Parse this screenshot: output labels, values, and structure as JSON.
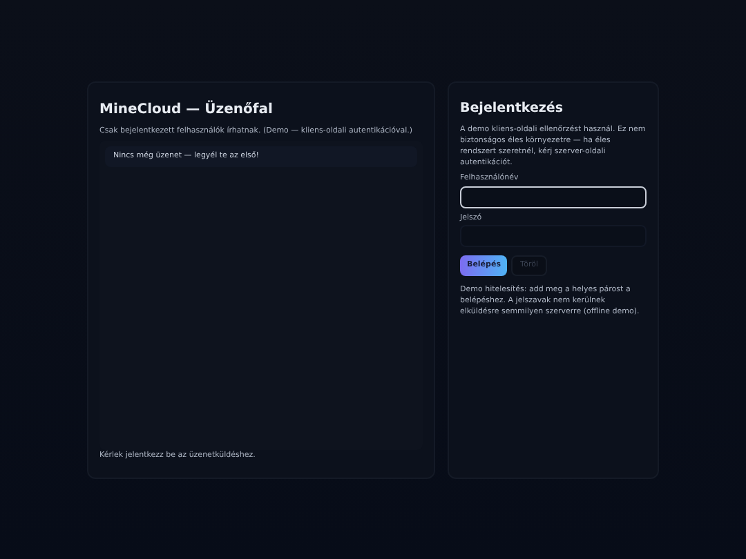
{
  "board": {
    "title": "MineCloud — Üzenőfal",
    "subtitle": "Csak bejelentkezett felhasználók írhatnak. (Demo — kliens-oldali autentikációval.)",
    "empty": "Nincs még üzenet — legyél te az első!",
    "footer": "Kérlek jelentkezz be az üzenetküldéshez."
  },
  "login": {
    "title": "Bejelentkezés",
    "notice": "A demo kliens-oldali ellenőrzést használ. Ez nem biztonságos éles környezetre — ha éles rendszert szeretnél, kérj szerver-oldali autentikációt.",
    "fields": [
      {
        "label": "Felhasználónév",
        "focused": true
      },
      {
        "label": "Jelszó",
        "focused": false
      }
    ],
    "buttons": [
      {
        "label": "Belépés",
        "kind": "primary"
      },
      {
        "label": "Töröl",
        "kind": "secondary"
      }
    ],
    "help": "Demo hitelesítés: add meg a helyes párost a belépéshez. A jelszavak nem kerülnek elküldésre semmilyen szerverre (offline demo)."
  }
}
